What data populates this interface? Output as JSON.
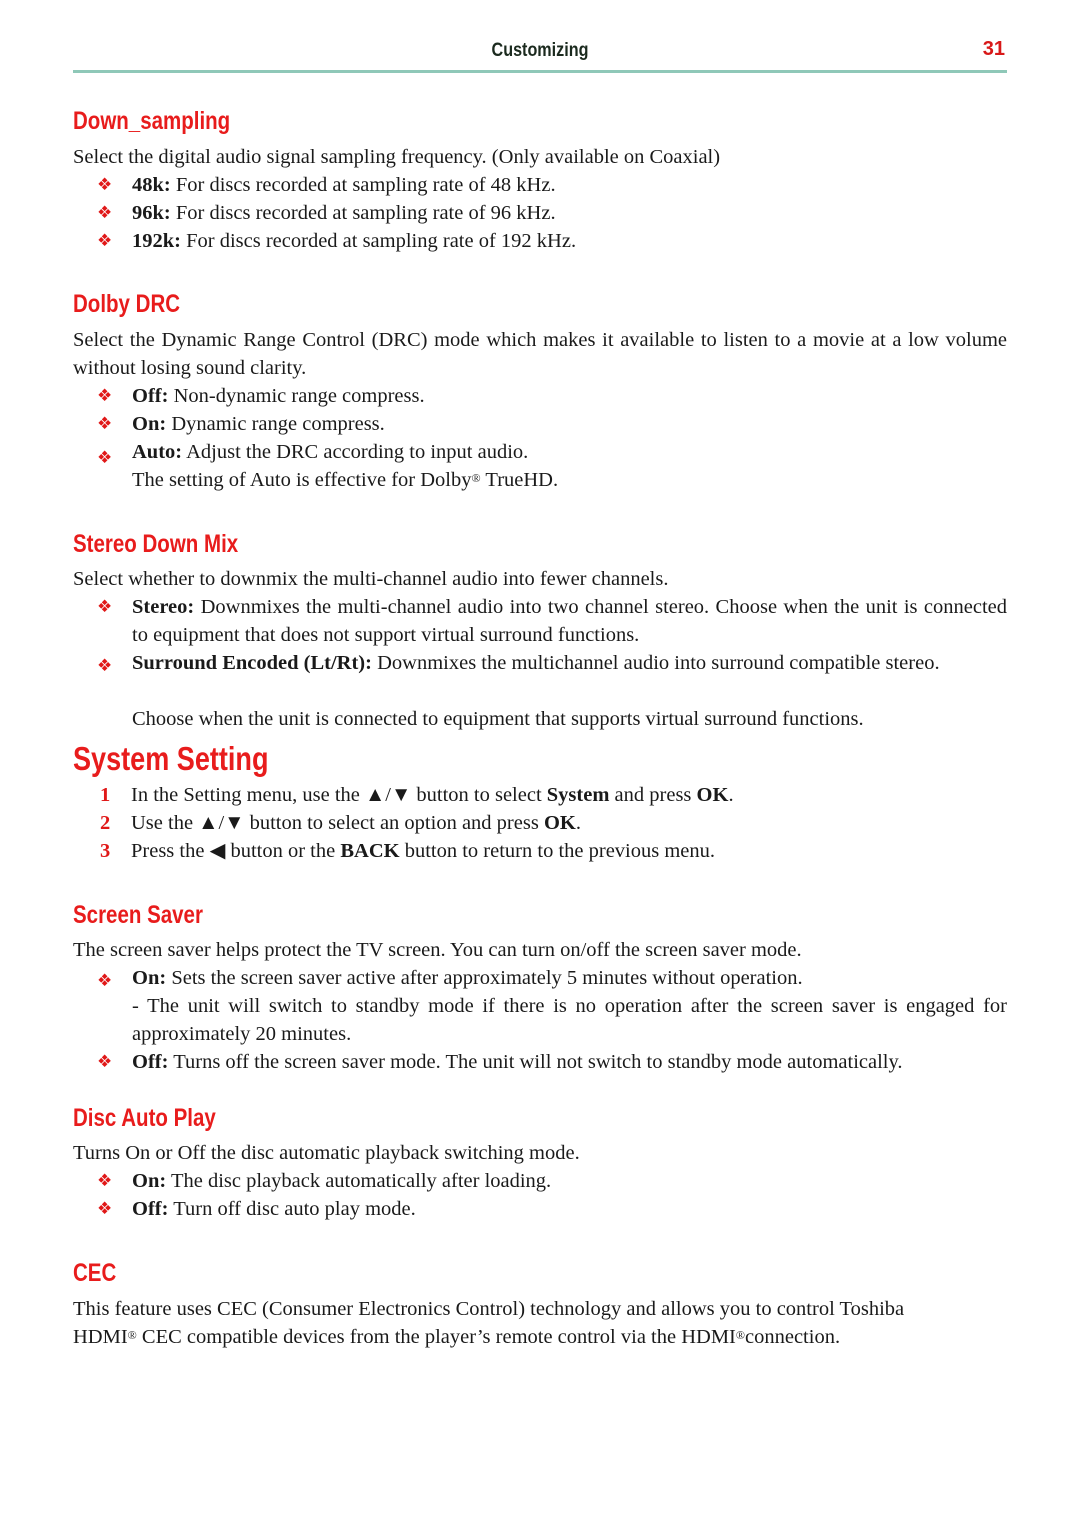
{
  "header": {
    "title": "Customizing",
    "page_number": "31"
  },
  "downsampling": {
    "heading": "Down_sampling",
    "intro": "Select the digital audio signal sampling frequency. (Only available on Coaxial)",
    "items": [
      {
        "label": "48k:",
        "text": " For discs recorded at sampling rate of 48 kHz."
      },
      {
        "label": "96k:",
        "text": " For discs recorded at sampling rate of 96 kHz."
      },
      {
        "label": "192k:",
        "text": " For discs recorded at sampling rate of 192 kHz."
      }
    ]
  },
  "dolby_drc": {
    "heading": "Dolby DRC",
    "intro": "Select the Dynamic Range Control (DRC) mode which makes it available to listen to a movie at a low volume without losing sound clarity.",
    "items": [
      {
        "label": "Off:",
        "text": " Non-dynamic range compress."
      },
      {
        "label": "On:",
        "text": " Dynamic range compress."
      },
      {
        "label": "Auto:",
        "text": " Adjust the DRC according to input audio."
      }
    ],
    "note_pre": "The setting of Auto is effective for Dolby",
    "note_sup": "®",
    "note_post": " TrueHD."
  },
  "stereo_down_mix": {
    "heading": "Stereo Down Mix",
    "intro": "Select whether to downmix the multi-channel audio into fewer channels.",
    "items": [
      {
        "label": "Stereo:",
        "text": " Downmixes the multi-channel audio into two channel stereo. Choose when the unit is connected to equipment that does not support virtual surround functions."
      },
      {
        "label": "Surround Encoded (Lt/Rt):",
        "text": " Downmixes the multichannel audio into surround compatible stereo."
      }
    ],
    "continuation": "Choose when the unit is connected to equipment that supports virtual surround functions."
  },
  "system_setting": {
    "heading": "System Setting",
    "steps": [
      {
        "num": "1",
        "parts": [
          "In the Setting menu, use the ▲/▼ button to select ",
          "System",
          " and press ",
          "OK",
          "."
        ]
      },
      {
        "num": "2",
        "parts": [
          "Use the ▲/▼ button to select an option and press ",
          "OK",
          "."
        ]
      },
      {
        "num": "3",
        "parts": [
          "Press the ◀ button or the ",
          "BACK",
          " button to return to the previous menu."
        ]
      }
    ]
  },
  "screen_saver": {
    "heading": "Screen Saver",
    "intro": "The screen saver helps protect the TV screen. You can turn on/off the screen saver mode.",
    "items": [
      {
        "label": "On:",
        "text": " Sets the screen saver active after approximately 5 minutes without operation."
      },
      {
        "label": "Off:",
        "text": " Turns off the screen saver mode. The unit will not switch to standby mode automatically."
      }
    ],
    "on_note": "- The unit will switch to standby mode if there is no operation after the screen saver is engaged for approximately 20 minutes."
  },
  "disc_auto_play": {
    "heading": "Disc Auto Play",
    "intro": "Turns On or Off the disc automatic playback switching mode.",
    "items": [
      {
        "label": "On:",
        "text": " The disc playback automatically after loading."
      },
      {
        "label": "Off:",
        "text": " Turn off disc auto play mode."
      }
    ]
  },
  "cec": {
    "heading": "CEC",
    "line1": "This feature uses CEC (Consumer Electronics Control) technology and allows you to control Toshiba",
    "line2_a": "HDMI",
    "line2_sup1": "®",
    "line2_b": " CEC compatible devices from the player’s remote control via the HDMI",
    "line2_sup2": "®",
    "line2_c": "connection."
  },
  "bullet_glyph": "❖"
}
